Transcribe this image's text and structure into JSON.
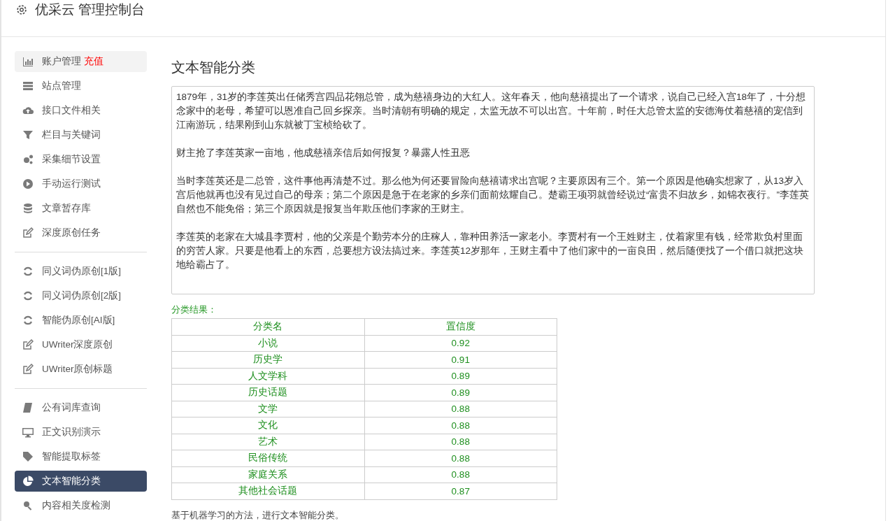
{
  "header": {
    "title": "优采云 管理控制台"
  },
  "sidebar": {
    "groups": [
      [
        {
          "label": "账户管理",
          "badge": "充值",
          "hovered": true,
          "selected": false
        },
        {
          "label": "站点管理",
          "hovered": false,
          "selected": false
        },
        {
          "label": "接口文件相关",
          "hovered": false,
          "selected": false
        },
        {
          "label": "栏目与关键词",
          "hovered": false,
          "selected": false
        },
        {
          "label": "采集细节设置",
          "hovered": false,
          "selected": false
        },
        {
          "label": "手动运行测试",
          "hovered": false,
          "selected": false
        },
        {
          "label": "文章暂存库",
          "hovered": false,
          "selected": false
        },
        {
          "label": "深度原创任务",
          "hovered": false,
          "selected": false
        }
      ],
      [
        {
          "label": "同义词伪原创[1版]",
          "hovered": false,
          "selected": false
        },
        {
          "label": "同义词伪原创[2版]",
          "hovered": false,
          "selected": false
        },
        {
          "label": "智能伪原创[AI版]",
          "hovered": false,
          "selected": false
        },
        {
          "label": "UWriter深度原创",
          "hovered": false,
          "selected": false
        },
        {
          "label": "UWriter原创标题",
          "hovered": false,
          "selected": false
        }
      ],
      [
        {
          "label": "公有词库查询",
          "hovered": false,
          "selected": false
        },
        {
          "label": "正文识别演示",
          "hovered": false,
          "selected": false
        },
        {
          "label": "智能提取标签",
          "hovered": false,
          "selected": false
        },
        {
          "label": "文本智能分类",
          "hovered": false,
          "selected": true
        },
        {
          "label": "内容相关度检测",
          "hovered": false,
          "selected": false
        }
      ]
    ]
  },
  "main": {
    "title": "文本智能分类",
    "text_input": {
      "paragraphs": [
        "1879年，31岁的李莲英出任储秀宫四品花翎总管，成为慈禧身边的大红人。这年春天，他向慈禧提出了一个请求，说自己已经入宫18年了，十分想念家中的老母，希望可以恩准自己回乡探亲。当时清朝有明确的规定，太监无故不可以出宫。十年前，时任大总管太监的安德海仗着慈禧的宠信到江南游玩，结果刚到山东就被丁宝桢给砍了。",
        "财主抢了李莲英家一亩地，他成慈禧亲信后如何报复？暴露人性丑恶",
        "当时李莲英还是二总管，这件事他再清楚不过。那么他为何还要冒险向慈禧请求出宫呢？主要原因有三个。第一个原因是他确实想家了，从13岁入宫后他就再也没有见过自己的母亲；第二个原因是急于在老家的乡亲们面前炫耀自己。楚霸王项羽就曾经说过“富贵不归故乡，如锦衣夜行。”李莲英自然也不能免俗；第三个原因就是报复当年欺压他们李家的王财主。",
        "李莲英的老家在大城县李贾村，他的父亲是个勤劳本分的庄稼人，靠种田养活一家老小。李贾村有一个王姓财主，仗着家里有钱，经常欺负村里面的穷苦人家。只要是他看上的东西，总要想方设法搞过来。李莲英12岁那年，王财主看中了他们家中的一亩良田，然后随便找了一个借口就把这块地给霸占了。"
      ]
    },
    "result_label": "分类结果：",
    "table": {
      "columns": [
        "分类名",
        "置信度"
      ],
      "rows": [
        {
          "name": "小说",
          "score": "0.92"
        },
        {
          "name": "历史学",
          "score": "0.91"
        },
        {
          "name": "人文学科",
          "score": "0.89"
        },
        {
          "name": "历史话题",
          "score": "0.89"
        },
        {
          "name": "文学",
          "score": "0.88"
        },
        {
          "name": "文化",
          "score": "0.88"
        },
        {
          "name": "艺术",
          "score": "0.88"
        },
        {
          "name": "民俗传统",
          "score": "0.88"
        },
        {
          "name": "家庭关系",
          "score": "0.88"
        },
        {
          "name": "其他社会话题",
          "score": "0.87"
        }
      ]
    },
    "note": "基于机器学习的方法，进行文本智能分类。"
  }
}
